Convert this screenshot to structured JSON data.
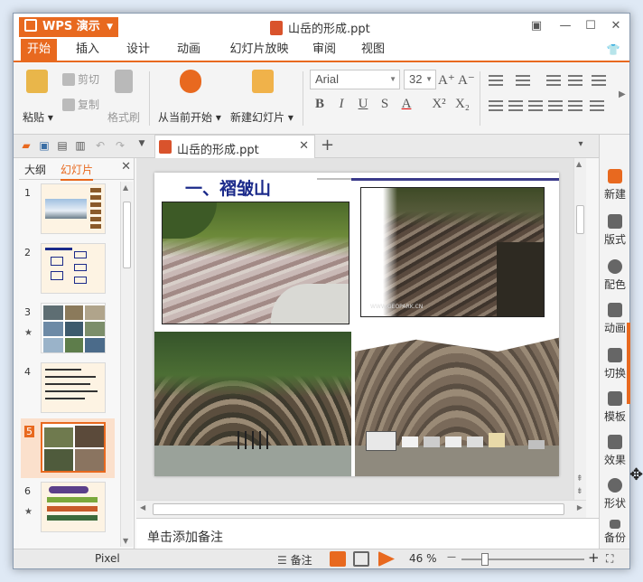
{
  "app": {
    "name": "WPS 演示",
    "doc_title": "山岳的形成.ppt"
  },
  "window_controls": {
    "skin": "▣",
    "minimize": "—",
    "maximize": "☐",
    "close": "✕",
    "tshirt": "👕"
  },
  "menu_tabs": [
    {
      "label": "开始",
      "active": true
    },
    {
      "label": "插入"
    },
    {
      "label": "设计"
    },
    {
      "label": "动画"
    },
    {
      "label": "幻灯片放映"
    },
    {
      "label": "审阅"
    },
    {
      "label": "视图"
    }
  ],
  "ribbon": {
    "paste": "粘贴",
    "cut": "剪切",
    "copy": "复制",
    "format_painter": "格式刷",
    "from_current": "从当前开始",
    "new_slide": "新建幻灯片",
    "font_name": "Arial",
    "font_size": "32",
    "bold": "B",
    "italic": "I",
    "underline": "U",
    "shadow": "S",
    "font_color": "A",
    "superscript": "X²",
    "subscript": "X₂",
    "grow": "A⁺",
    "shrink": "A⁻"
  },
  "doc_tab": {
    "name": "山岳的形成.ppt",
    "close": "✕",
    "new": "+"
  },
  "left_pane": {
    "tab_outline": "大纲",
    "tab_slides": "幻灯片",
    "close": "✕",
    "slides": [
      {
        "num": "1"
      },
      {
        "num": "2"
      },
      {
        "num": "3",
        "star": true
      },
      {
        "num": "4"
      },
      {
        "num": "5",
        "selected": true
      },
      {
        "num": "6",
        "star": true
      }
    ]
  },
  "slide": {
    "title": "一、褶皱山",
    "watermark": "WWW.GEOPARK.CN"
  },
  "notes": {
    "placeholder": "单击添加备注"
  },
  "right_bar": [
    {
      "label": "新建",
      "color": "#e8691f"
    },
    {
      "label": "版式",
      "color": "#555555"
    },
    {
      "label": "配色",
      "color": "#555555"
    },
    {
      "label": "动画",
      "color": "#555555"
    },
    {
      "label": "切换",
      "color": "#555555"
    },
    {
      "label": "模板",
      "color": "#555555"
    },
    {
      "label": "效果",
      "color": "#555555"
    },
    {
      "label": "形状",
      "color": "#555555"
    },
    {
      "label": "备份",
      "color": "#555555"
    }
  ],
  "status": {
    "font_name": "Pixel",
    "notes_label": "备注",
    "zoom": "46 %",
    "zoom_percent": 46,
    "zoom_minus": "—",
    "zoom_plus": "+"
  },
  "colors": {
    "accent": "#e8691f",
    "title_blue": "#1b2a8a"
  }
}
